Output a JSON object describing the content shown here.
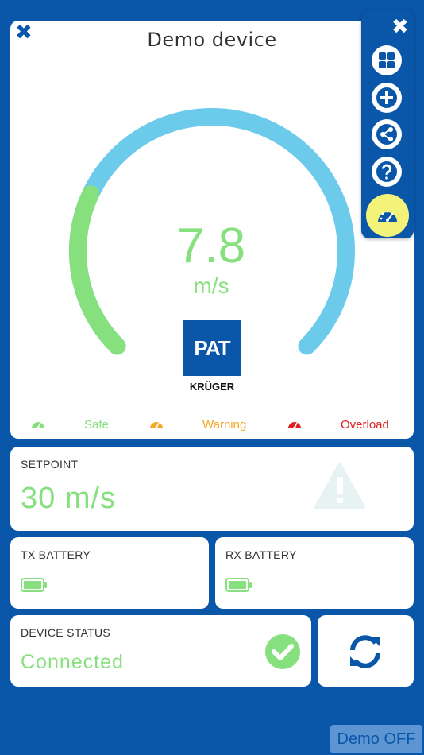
{
  "gauge_card": {
    "title": "Demo device",
    "reading": "7.8",
    "unit": "m/s",
    "gauge_fraction": 0.26,
    "logo_top": "PAT",
    "logo_bottom": "KRÜGER"
  },
  "legend": [
    {
      "label": "Safe",
      "color": "#86e07d"
    },
    {
      "label": "Warning",
      "color": "#f5a623"
    },
    {
      "label": "Overload",
      "color": "#e02020"
    }
  ],
  "colors": {
    "background": "#0a56a8",
    "gauge_track": "#6ccaea",
    "gauge_fill": "#86e07d",
    "menu_active": "#f3f37a"
  },
  "side_menu": {
    "items": [
      "dashboard-icon",
      "add-icon",
      "share-icon",
      "help-icon",
      "gauge-icon"
    ]
  },
  "setpoint": {
    "label": "SETPOINT",
    "value": "30 m/s"
  },
  "tx_battery": {
    "label": "TX BATTERY"
  },
  "rx_battery": {
    "label": "RX BATTERY"
  },
  "device_status": {
    "label": "DEVICE STATUS",
    "value": "Connected"
  },
  "demo_button": {
    "label": "Demo OFF"
  }
}
